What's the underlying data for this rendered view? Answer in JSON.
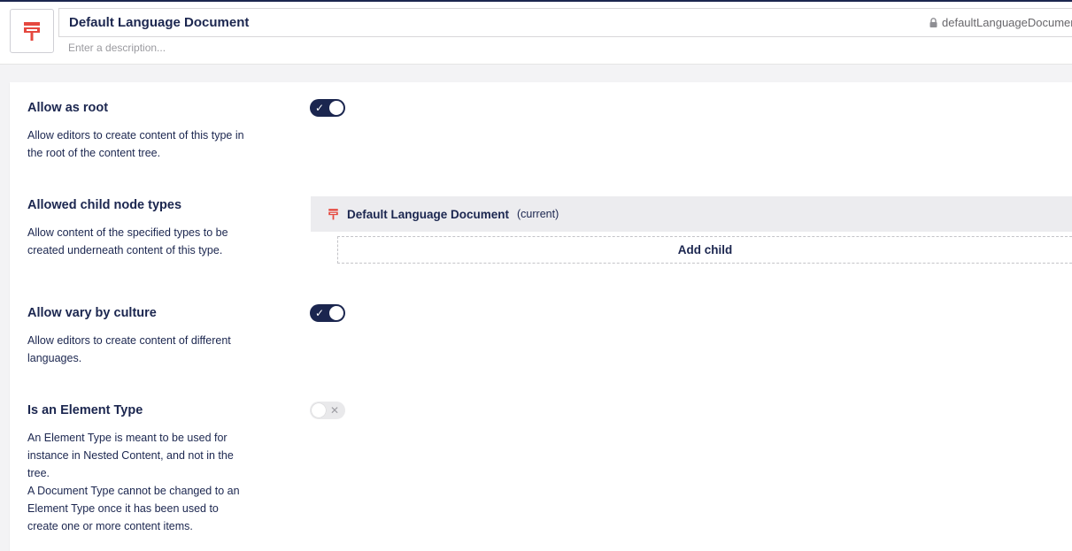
{
  "header": {
    "name_value": "Default Language Document",
    "description_placeholder": "Enter a description...",
    "alias": "defaultLanguageDocument",
    "icon": "stamp-icon",
    "icon_color": "#e5483f"
  },
  "settings": {
    "allow_root": {
      "title": "Allow as root",
      "description": "Allow editors to create content of this type in the root of the content tree.",
      "enabled": true
    },
    "allowed_children": {
      "title": "Allowed child node types",
      "description": "Allow content of the specified types to be created underneath content of this type.",
      "items": [
        {
          "name": "Default Language Document",
          "suffix": "(current)",
          "icon": "stamp-icon"
        }
      ],
      "add_label": "Add child"
    },
    "vary_culture": {
      "title": "Allow vary by culture",
      "description": "Allow editors to create content of different languages.",
      "enabled": true
    },
    "element_type": {
      "title": "Is an Element Type",
      "description_1": "An Element Type is meant to be used for instance in Nested Content, and not in the tree.",
      "description_2": "A Document Type cannot be changed to an Element Type once it has been used to create one or more content items.",
      "enabled": false
    }
  },
  "colors": {
    "primary": "#1b264f",
    "accent": "#e5483f",
    "background": "#f3f3f5"
  }
}
